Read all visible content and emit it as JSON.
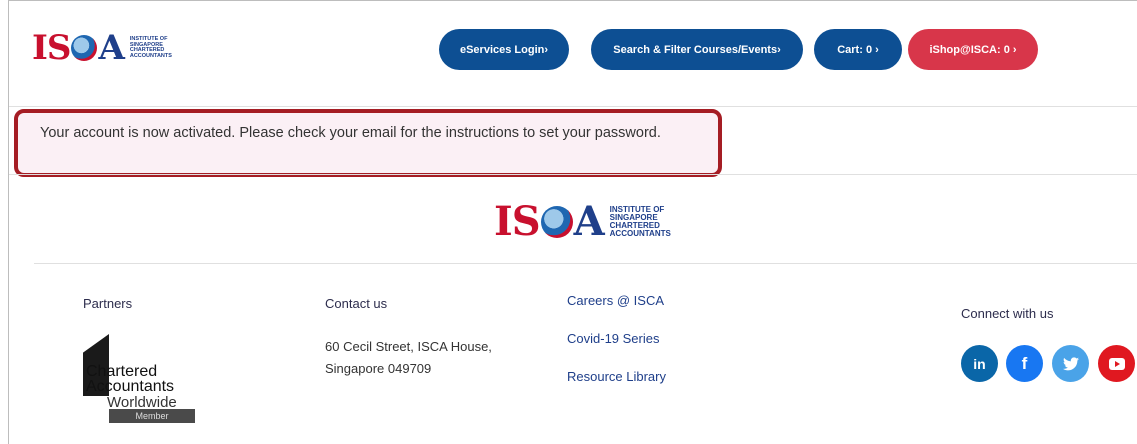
{
  "header": {
    "logo_words": [
      "INSTITUTE OF",
      "SINGAPORE",
      "CHARTERED",
      "ACCOUNTANTS"
    ],
    "eservices_label": "eServices Login›",
    "search_label": "Search & Filter Courses/Events›",
    "cart_label": "Cart: 0 ›",
    "ishop_label": "iShop@ISCA: 0 ›"
  },
  "alert": {
    "message": "Your account is now activated. Please check your email for the instructions to set your password."
  },
  "footer": {
    "partners_label": "Partners",
    "contact_label": "Contact us",
    "address_line1": "60 Cecil Street, ISCA House,",
    "address_line2": "Singapore 049709",
    "links": [
      "Careers @ ISCA",
      "Covid-19 Series",
      "Resource Library"
    ],
    "connect_label": "Connect with us",
    "caw_line1": "Chartered",
    "caw_line2": "Accountants",
    "caw_line3": "Worldwide",
    "caw_member": "Member",
    "social_icons": [
      "linkedin-icon",
      "facebook-icon",
      "twitter-icon",
      "youtube-icon"
    ],
    "colors": {
      "linkedin": "#0a66a8",
      "facebook": "#1877f2",
      "twitter": "#4aa3e8",
      "youtube": "#e01820"
    }
  },
  "colors": {
    "primary_blue": "#0d4f93",
    "accent_red": "#d8364a",
    "alert_border": "#a51d24",
    "alert_bg": "#fbf0f5"
  }
}
